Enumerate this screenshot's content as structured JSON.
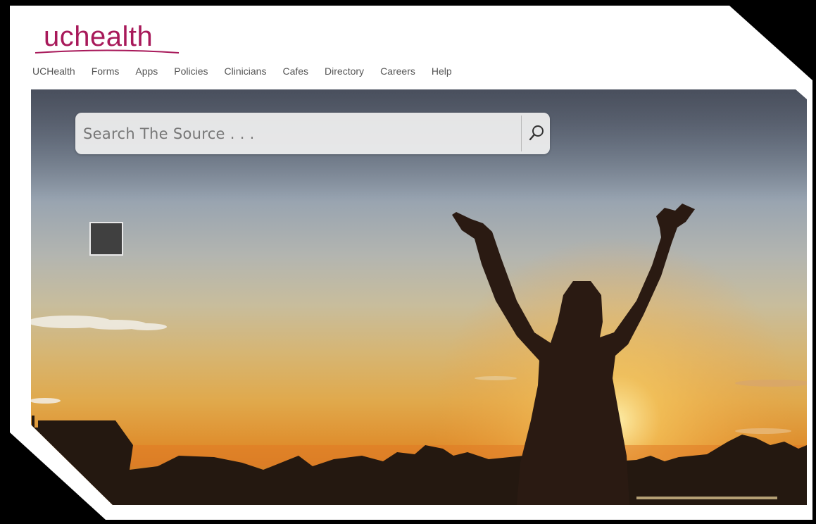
{
  "brand": {
    "logo_text": "uchealth",
    "logo_color": "#a8195a"
  },
  "nav": {
    "items": [
      {
        "label": "UCHealth"
      },
      {
        "label": "Forms"
      },
      {
        "label": "Apps"
      },
      {
        "label": "Policies"
      },
      {
        "label": "Clinicians"
      },
      {
        "label": "Cafes"
      },
      {
        "label": "Directory"
      },
      {
        "label": "Careers"
      },
      {
        "label": "Help"
      }
    ]
  },
  "search": {
    "placeholder": "Search The Source . . .",
    "value": "",
    "icon": "search-icon"
  },
  "widget": {
    "icon": "square-tile"
  },
  "colors": {
    "nav_text": "#555555",
    "search_bg": "#eeeeee",
    "sky_top": "#5a6070",
    "sunset_glow": "#df8d2c"
  }
}
